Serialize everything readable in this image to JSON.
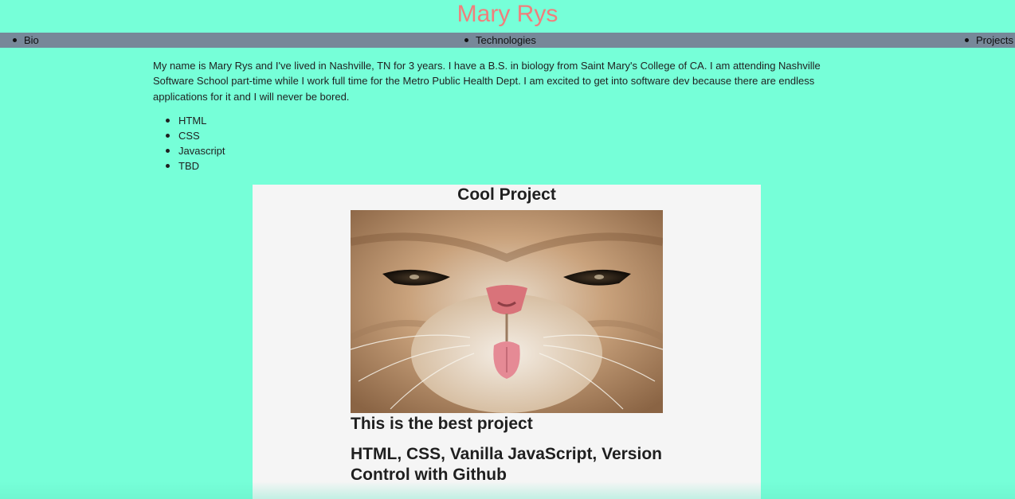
{
  "site": {
    "title": "Mary Rys",
    "title_color": "#f07f7c",
    "background_color": "#76ffd8",
    "nav_color": "#778899"
  },
  "nav": {
    "items": [
      {
        "label": "Bio"
      },
      {
        "label": "Technologies"
      },
      {
        "label": "Projects"
      }
    ]
  },
  "bio": {
    "text": "My name is Mary Rys and I've lived in Nashville, TN for 3 years. I have a B.S. in biology from Saint Mary's College of CA. I am attending Nashville Software School part-time while I work full time for the Metro Public Health Dept. I am excited to get into software dev because there are endless applications for it and I will never be bored."
  },
  "technologies": {
    "items": [
      "HTML",
      "CSS",
      "Javascript",
      "TBD"
    ]
  },
  "project": {
    "title": "Cool Project",
    "image_icon": "cat-photo",
    "description": "This is the best project",
    "tech": "HTML, CSS, Vanilla JavaScript, Version Control with Github"
  }
}
